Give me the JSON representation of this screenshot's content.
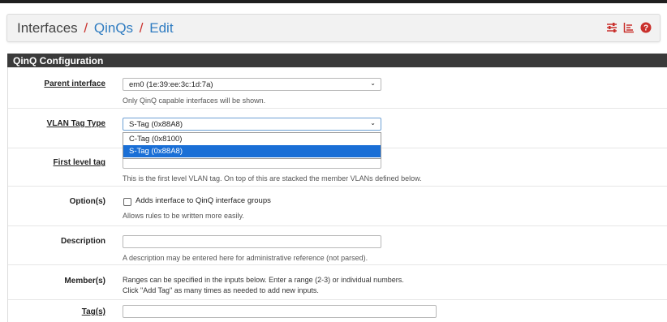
{
  "breadcrumb": {
    "root": "Interfaces",
    "sep1": "/",
    "section": "QinQs",
    "sep2": "/",
    "page": "Edit"
  },
  "header_icons": [
    "sliders-icon",
    "list-chart-icon",
    "help-icon"
  ],
  "panel": {
    "title": "QinQ Configuration",
    "parent_interface": {
      "label": "Parent interface",
      "value": "em0 (1e:39:ee:3c:1d:7a)",
      "help": "Only QinQ capable interfaces will be shown."
    },
    "vlan_tag_type": {
      "label": "VLAN Tag Type",
      "value": "S-Tag (0x88A8)",
      "options": [
        "C-Tag (0x8100)",
        "S-Tag (0x88A8)"
      ]
    },
    "first_level_tag": {
      "label": "First level tag",
      "value": "",
      "help": "This is the first level VLAN tag. On top of this are stacked the member VLANs defined below."
    },
    "options": {
      "label": "Option(s)",
      "checkbox_label": "Adds interface to QinQ interface groups",
      "checked": false,
      "help": "Allows rules to be written more easily."
    },
    "description": {
      "label": "Description",
      "value": "",
      "help": "A description may be entered here for administrative reference (not parsed)."
    },
    "members": {
      "label": "Member(s)",
      "help_line1": "Ranges can be specified in the inputs below. Enter a range (2-3) or individual numbers.",
      "help_line2": "Click \"Add Tag\" as many times as needed to add new inputs."
    },
    "tags": {
      "label": "Tag(s)",
      "value": ""
    }
  },
  "colors": {
    "link": "#2f7cc1",
    "separator": "#c9302c",
    "panel_heading": "#3a3a3a",
    "selected_option": "#1a6fd6"
  }
}
